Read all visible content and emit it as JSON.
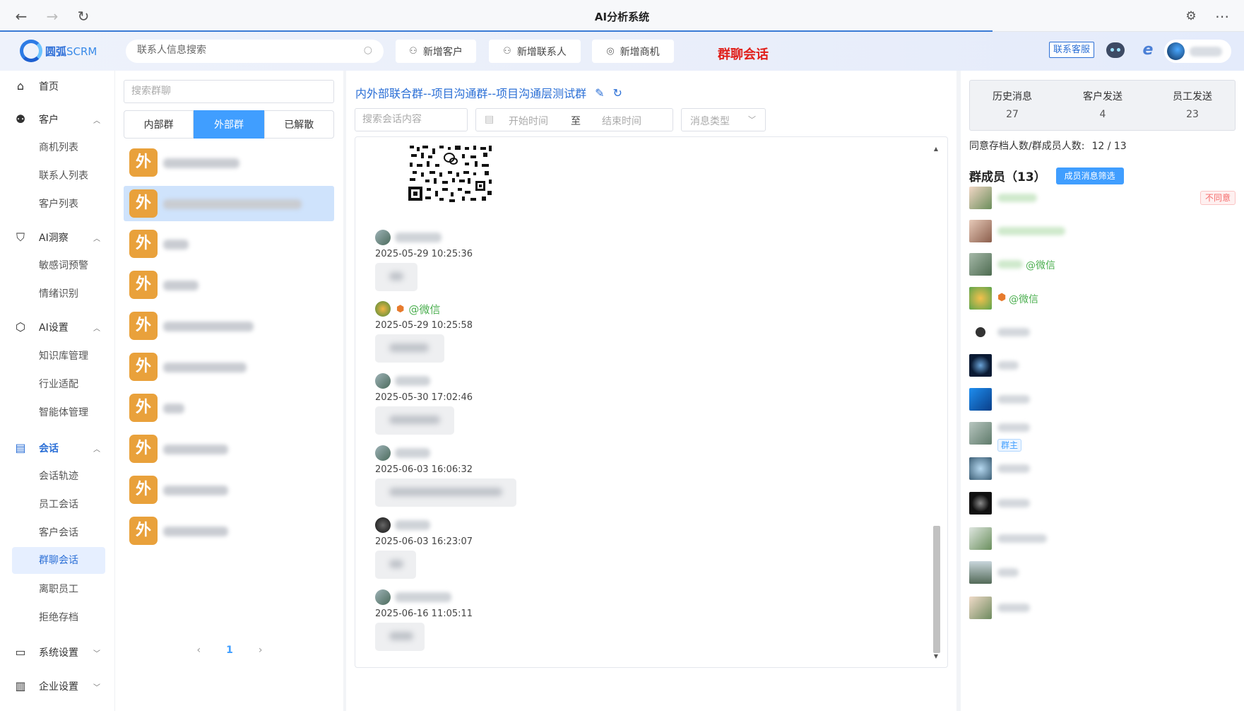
{
  "browser": {
    "title": "AI分析系统"
  },
  "header": {
    "logo_brand": "圆弧",
    "logo_suffix": "SCRM",
    "search_placeholder": "联系人信息搜索",
    "buttons": {
      "add_customer": "新增客户",
      "add_contact": "新增联系人",
      "add_opportunity": "新增商机"
    },
    "page_heading": "群聊会话",
    "service_label": "联系客服"
  },
  "sidebar": {
    "home": "首页",
    "customer": "客户",
    "customer_items": [
      "商机列表",
      "联系人列表",
      "客户列表"
    ],
    "ai_insight": "AI洞察",
    "ai_insight_items": [
      "敏感词预警",
      "情绪识别"
    ],
    "ai_settings": "AI设置",
    "ai_settings_items": [
      "知识库管理",
      "行业适配",
      "智能体管理"
    ],
    "session": "会话",
    "session_items": [
      "会话轨迹",
      "员工会话",
      "客户会话",
      "群聊会话",
      "离职员工",
      "拒绝存档"
    ],
    "system_settings": "系统设置",
    "enterprise_settings": "企业设置"
  },
  "groups": {
    "search_placeholder": "搜索群聊",
    "tabs": [
      "内部群",
      "外部群",
      "已解散"
    ],
    "badge": "外",
    "page": "1"
  },
  "chat": {
    "title": "内外部联合群--项目沟通群--项目沟通层测试群",
    "search_placeholder": "搜索会话内容",
    "start_placeholder": "开始时间",
    "to_label": "至",
    "end_placeholder": "结束时间",
    "type_placeholder": "消息类型",
    "messages": [
      {
        "sender": "",
        "time": "2025-05-29 10:25:36"
      },
      {
        "sender": "@微信",
        "time": "2025-05-29 10:25:58"
      },
      {
        "sender": "",
        "time": "2025-05-30 17:02:46"
      },
      {
        "sender": "",
        "time": "2025-06-03 16:06:32"
      },
      {
        "sender": "",
        "time": "2025-06-03 16:23:07"
      },
      {
        "sender": "",
        "time": "2025-06-16 11:05:11"
      }
    ]
  },
  "stats": {
    "history_label": "历史消息",
    "history_value": "27",
    "customer_label": "客户发送",
    "customer_value": "4",
    "staff_label": "员工发送",
    "staff_value": "23"
  },
  "consent": {
    "label": "同意存档人数/群成员人数:",
    "value": "12 / 13"
  },
  "members": {
    "title": "群成员（13）",
    "filter_button": "成员消息筛选",
    "not_agree_tag": "不同意",
    "owner_tag": "群主",
    "wechat_suffix": "@微信"
  },
  "colors": {
    "accent": "#409eff",
    "brand": "#2b6fd6",
    "heading_red": "#e0201b",
    "badge_orange": "#e9a13b"
  }
}
